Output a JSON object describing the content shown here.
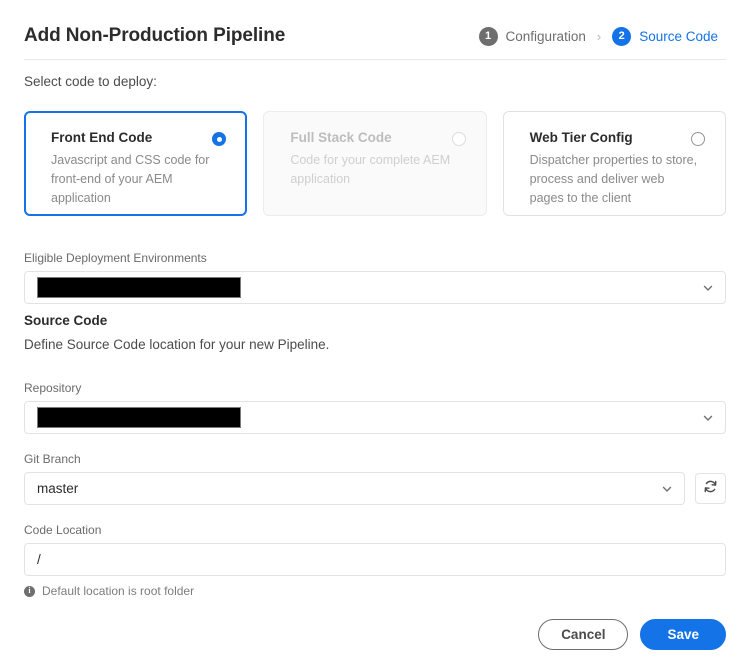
{
  "header": {
    "title": "Add Non-Production Pipeline",
    "steps": [
      {
        "num": "1",
        "label": "Configuration",
        "state": "done"
      },
      {
        "num": "2",
        "label": "Source Code",
        "state": "current"
      }
    ],
    "separator": "›"
  },
  "intro": "Select code to deploy:",
  "cards": [
    {
      "title": "Front End Code",
      "desc": "Javascript and CSS code for front-end of your AEM application",
      "selected": true,
      "disabled": false
    },
    {
      "title": "Full Stack Code",
      "desc": "Code for your complete AEM application",
      "selected": false,
      "disabled": true
    },
    {
      "title": "Web Tier Config",
      "desc": "Dispatcher properties to store, process and deliver web pages to the client",
      "selected": false,
      "disabled": false
    }
  ],
  "environments": {
    "label": "Eligible Deployment Environments",
    "value": "",
    "redacted": true
  },
  "source_code": {
    "heading": "Source Code",
    "description": "Define Source Code location for your new Pipeline."
  },
  "repository": {
    "label": "Repository",
    "value": "",
    "redacted": true
  },
  "git_branch": {
    "label": "Git Branch",
    "value": "master",
    "refresh_icon": "refresh-icon"
  },
  "code_location": {
    "label": "Code Location",
    "value": "/",
    "helper": "Default location is root folder",
    "helper_icon": "info-icon"
  },
  "footer": {
    "cancel_label": "Cancel",
    "save_label": "Save"
  },
  "colors": {
    "accent": "#1473e6",
    "step_done": "#6e6e6e",
    "border": "#e3e3e3",
    "text": "#2c2c2c",
    "muted": "#8a8a8a"
  }
}
